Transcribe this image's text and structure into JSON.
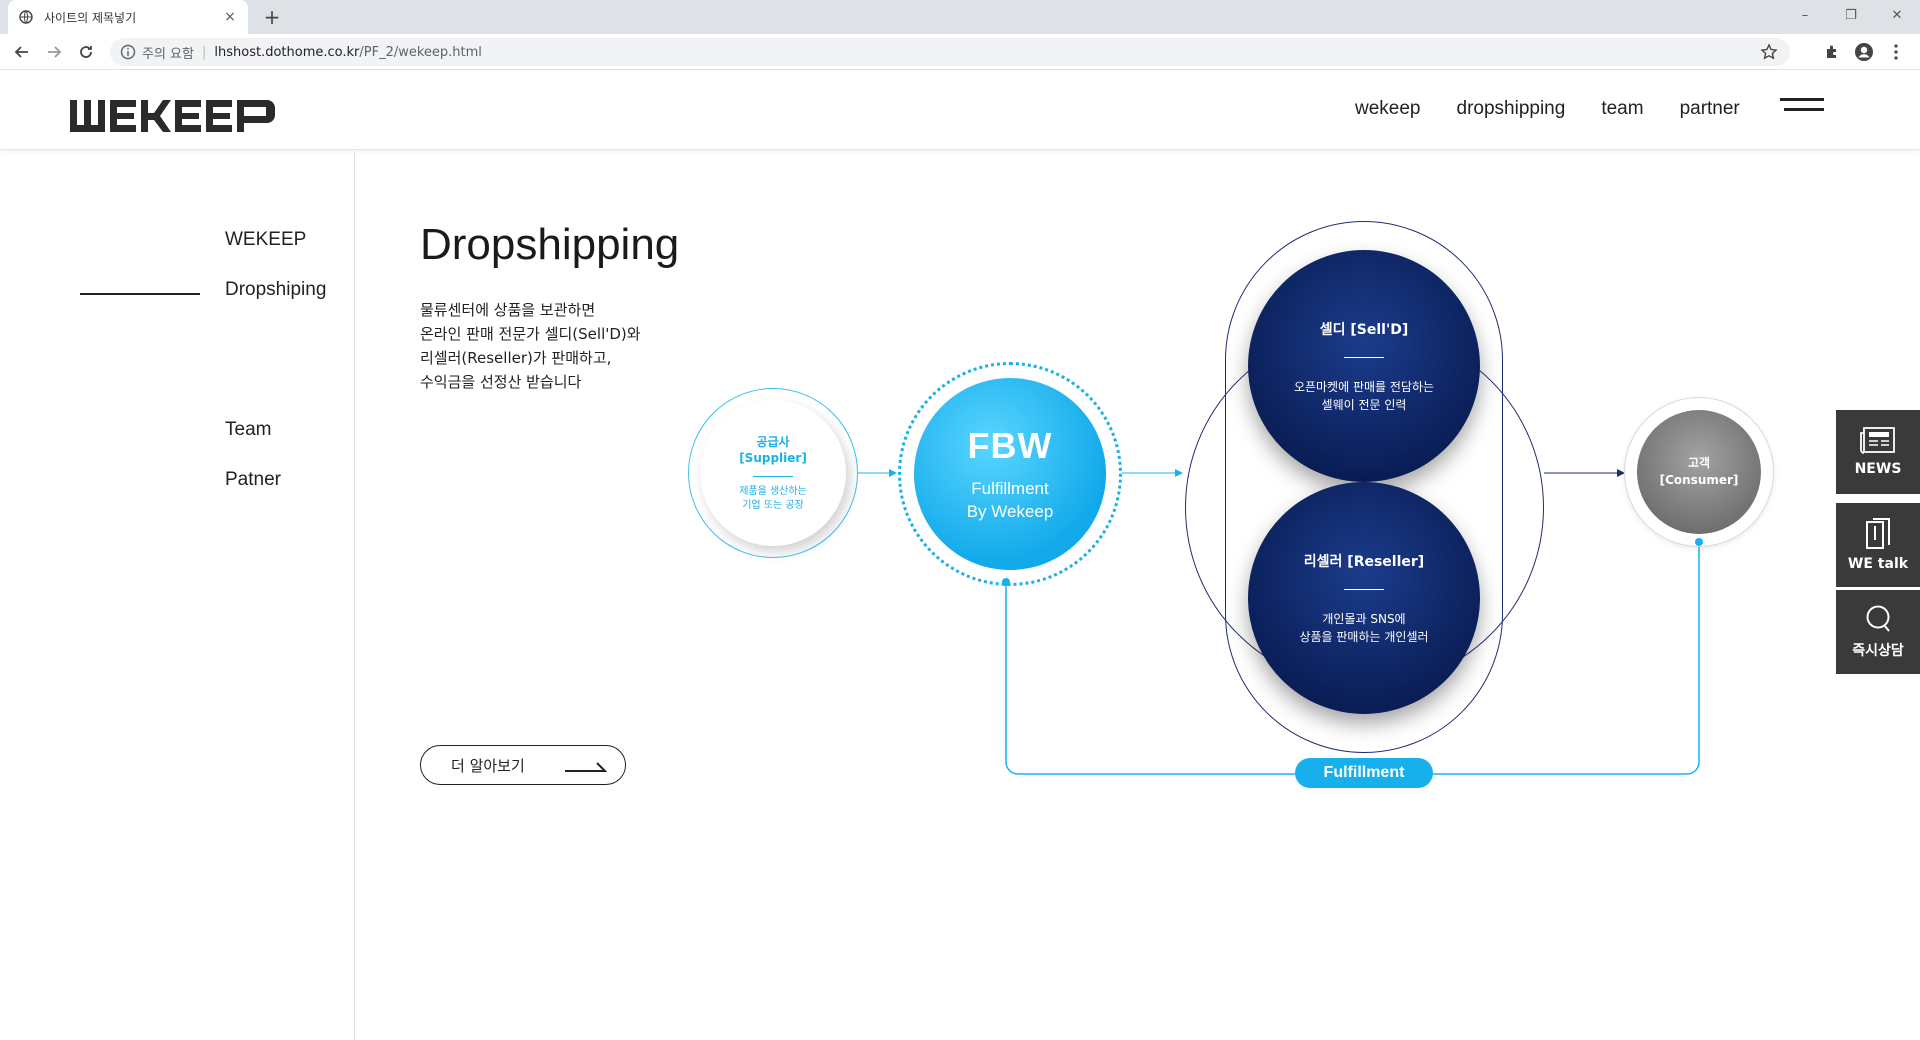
{
  "browser": {
    "tab_title": "사이트의 제목넣기",
    "new_tab": "+",
    "close_tab": "×",
    "security_label": "주의 요함",
    "url_host": "lhshost.dothome.co.kr",
    "url_path": "/PF_2/wekeep.html",
    "window_controls": [
      "–",
      "❐",
      "✕"
    ]
  },
  "header": {
    "logo": "WEKEEP",
    "nav": [
      "wekeep",
      "dropshipping",
      "team",
      "partner"
    ]
  },
  "sidebar": {
    "items": [
      {
        "label": "WEKEEP",
        "active": false
      },
      {
        "label": "Dropshiping",
        "active": true
      },
      {
        "label": "Team",
        "active": false
      },
      {
        "label": "Patner",
        "active": false
      }
    ]
  },
  "content": {
    "title": "Dropshipping",
    "description": [
      "물류센터에 상품을 보관하면",
      "온라인 판매 전문가 셀디(Sell'D)와",
      "리셀러(Reseller)가 판매하고,",
      "수익금을 선정산 받습니다"
    ],
    "more_button": "더 알아보기"
  },
  "diagram": {
    "supplier": {
      "title_1": "공급사",
      "title_2": "[Supplier]",
      "desc_1": "제품을 생산하는",
      "desc_2": "기업 또는 공장"
    },
    "fbw": {
      "title": "FBW",
      "sub_1": "Fulfillment",
      "sub_2": "By Wekeep"
    },
    "selld": {
      "title": "셀디 [Sell'D]",
      "desc_1": "오픈마켓에 판매를 전담하는",
      "desc_2": "셀웨이 전문 인력"
    },
    "reseller": {
      "title": "리셀러 [Reseller]",
      "desc_1": "개인몰과 SNS에",
      "desc_2": "상품을 판매하는 개인셀러"
    },
    "consumer": {
      "title_1": "고객",
      "title_2": "[Consumer]"
    },
    "fulfillment_label": "Fulfillment",
    "colors": {
      "sky": "#18b0ec",
      "navy": "#0a1d55",
      "gray": "#7a7a7a"
    }
  },
  "quick_menu": [
    {
      "label": "NEWS",
      "icon": "newspaper-icon"
    },
    {
      "label": "WE talk",
      "icon": "book-icon"
    },
    {
      "label": "즉시상담",
      "icon": "chat-icon"
    }
  ]
}
